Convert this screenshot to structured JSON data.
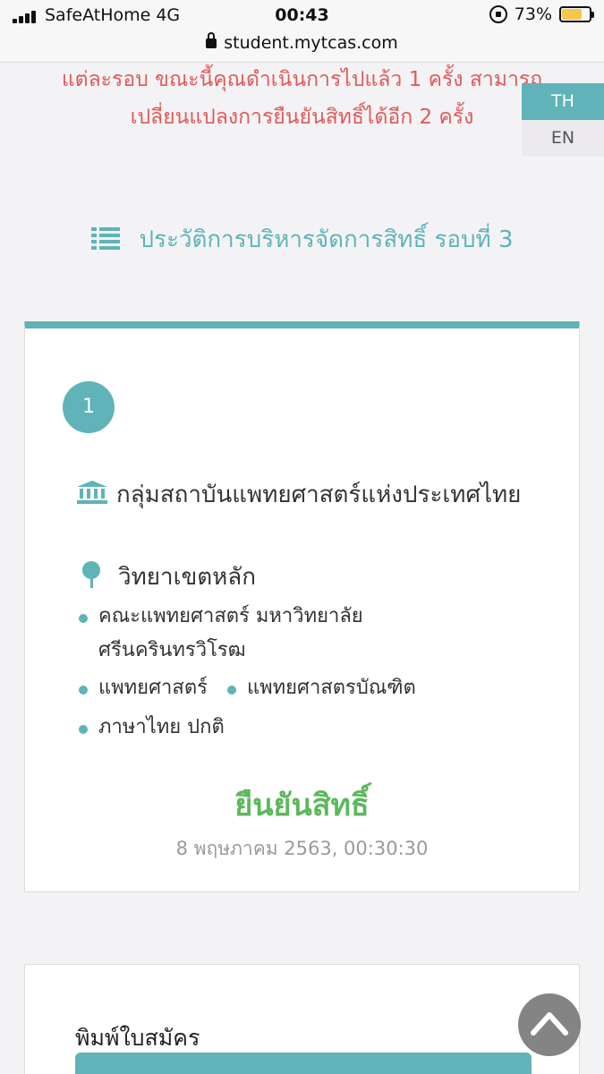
{
  "status_bar": {
    "carrier": "SafeAtHome  4G",
    "time": "00:43",
    "battery": "73%",
    "battery_level": 0.73,
    "url": "student.mytcas.com"
  },
  "warning": {
    "line1": "แต่ละรอบ ขณะนี้คุณดำเนินการไปแล้ว 1 ครั้ง สามารถ",
    "line2": "เปลี่ยนแปลงการยืนยันสิทธิ์ได้อีก 2 ครั้ง"
  },
  "lang": {
    "th": "TH",
    "en": "EN"
  },
  "history": {
    "title": "ประวัติการบริหารจัดการสิทธิ์ รอบที่ 3",
    "icon": "list-icon"
  },
  "record": {
    "step": "1",
    "institution": "กลุ่มสถาบันแพทยศาสตร์แห่งประเทศไทย",
    "campus": "วิทยาเขตหลัก",
    "faculty": "คณะแพทยศาสตร์ มหาวิทยาลัยศรีนครินทรวิโรฒ",
    "field": "แพทยศาสตร์",
    "degree": "แพทยศาสตรบัณฑิต",
    "program": "ภาษาไทย ปกติ",
    "status": "ยืนยันสิทธิ์",
    "timestamp": "8 พฤษภาคม 2563, 00:30:30"
  },
  "print": {
    "label": "พิมพ์ใบสมัคร"
  },
  "colors": {
    "accent": "#5fb3b9",
    "warning": "#e05a5a",
    "success": "#5cb85c"
  }
}
